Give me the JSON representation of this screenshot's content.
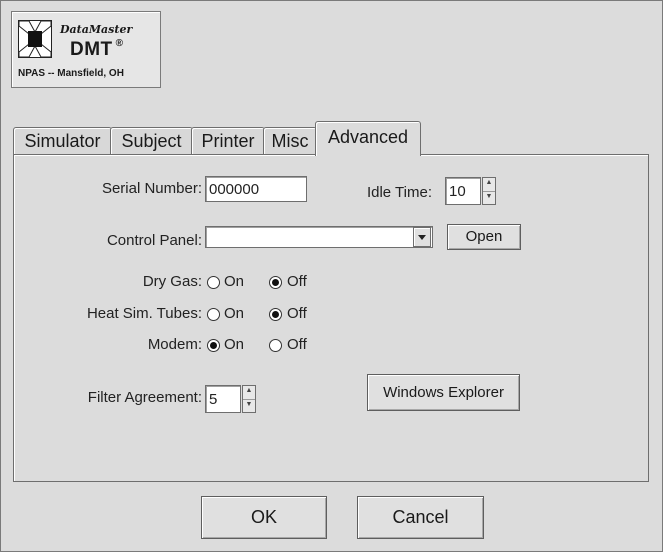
{
  "logo": {
    "brand": "DataMaster",
    "product": "DMT",
    "registered_mark": "®",
    "footer": "NPAS -- Mansfield, OH"
  },
  "tabs": [
    {
      "label": "Simulator",
      "active": false
    },
    {
      "label": "Subject",
      "active": false
    },
    {
      "label": "Printer",
      "active": false
    },
    {
      "label": "Misc",
      "active": false
    },
    {
      "label": "Advanced",
      "active": true
    }
  ],
  "advanced": {
    "serial_number": {
      "label": "Serial Number:",
      "value": "000000"
    },
    "idle_time": {
      "label": "Idle Time:",
      "value": "10"
    },
    "control_panel": {
      "label": "Control Panel:",
      "value": "",
      "open_label": "Open"
    },
    "dry_gas": {
      "label": "Dry Gas:",
      "on_label": "On",
      "off_label": "Off",
      "selected": "Off"
    },
    "heat_sim_tubes": {
      "label": "Heat Sim. Tubes:",
      "on_label": "On",
      "off_label": "Off",
      "selected": "Off"
    },
    "modem": {
      "label": "Modem:",
      "on_label": "On",
      "off_label": "Off",
      "selected": "On"
    },
    "filter_agreement": {
      "label": "Filter Agreement:",
      "value": "5"
    },
    "windows_explorer_label": "Windows Explorer"
  },
  "footer": {
    "ok_label": "OK",
    "cancel_label": "Cancel"
  },
  "icons": {
    "spin_up": "spin-up-arrow-icon",
    "spin_down": "spin-down-arrow-icon",
    "dropdown": "chevron-down-icon"
  },
  "colors": {
    "window_bg": "#dcdcdc",
    "field_bg": "#ffffff",
    "border": "#6e6e6e"
  }
}
